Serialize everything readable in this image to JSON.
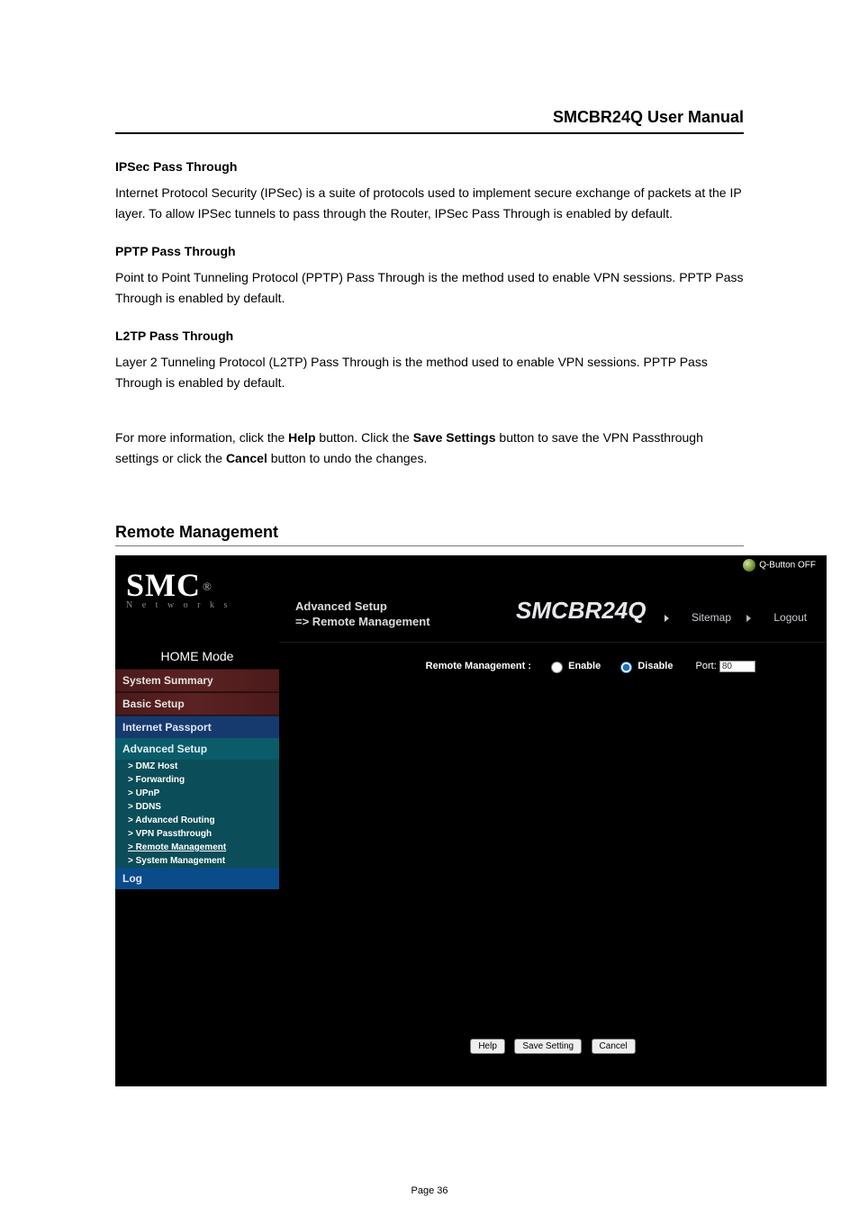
{
  "doc": {
    "header": "SMCBR24Q User Manual",
    "page_label": "Page 36",
    "sections": {
      "ipsec": {
        "title": "IPSec Pass Through",
        "body": "Internet Protocol Security (IPSec) is a suite of protocols used to implement secure exchange of packets at the IP layer. To allow IPSec tunnels to pass through the Router, IPSec Pass Through is enabled by default."
      },
      "pptp": {
        "title": "PPTP Pass Through",
        "body": "Point to Point Tunneling Protocol (PPTP) Pass Through is the method used to enable VPN sessions. PPTP Pass Through is enabled by default."
      },
      "l2tp": {
        "title": "L2TP Pass Through",
        "body": "Layer 2 Tunneling Protocol (L2TP) Pass Through is the method used to enable VPN sessions. PPTP Pass Through is enabled by default."
      },
      "more_a": "For more information, click the ",
      "help_word": "Help",
      "more_b": " button. Click the ",
      "save_word": "Save Settings",
      "more_c": " button to save the VPN Passthrough settings or click the ",
      "cancel_word": "Cancel",
      "more_d": " button to undo the changes."
    },
    "section_title": "Remote Management"
  },
  "ui": {
    "qbutton": "Q-Button OFF",
    "brand_big": "SMC",
    "brand_reg": "®",
    "brand_sub": "N e t w o r k s",
    "bc1": "Advanced Setup",
    "bc2": "=> Remote Management",
    "product": "SMCBR24Q",
    "sitemap": "Sitemap",
    "logout": "Logout",
    "nav": {
      "home": "HOME Mode",
      "summary": "System Summary",
      "basic": "Basic Setup",
      "passport": "Internet Passport",
      "advanced": "Advanced Setup",
      "log": "Log"
    },
    "sub": [
      "DMZ Host",
      "Forwarding",
      "UPnP",
      "DDNS",
      "Advanced Routing",
      "VPN Passthrough",
      "Remote Management",
      "System Management"
    ],
    "option": {
      "label": "Remote Management :",
      "enable": "Enable",
      "disable": "Disable",
      "selected": "disable",
      "port_label": "Port:",
      "port_value": "80"
    },
    "buttons": {
      "help": "Help",
      "save": "Save Setting",
      "cancel": "Cancel"
    }
  }
}
